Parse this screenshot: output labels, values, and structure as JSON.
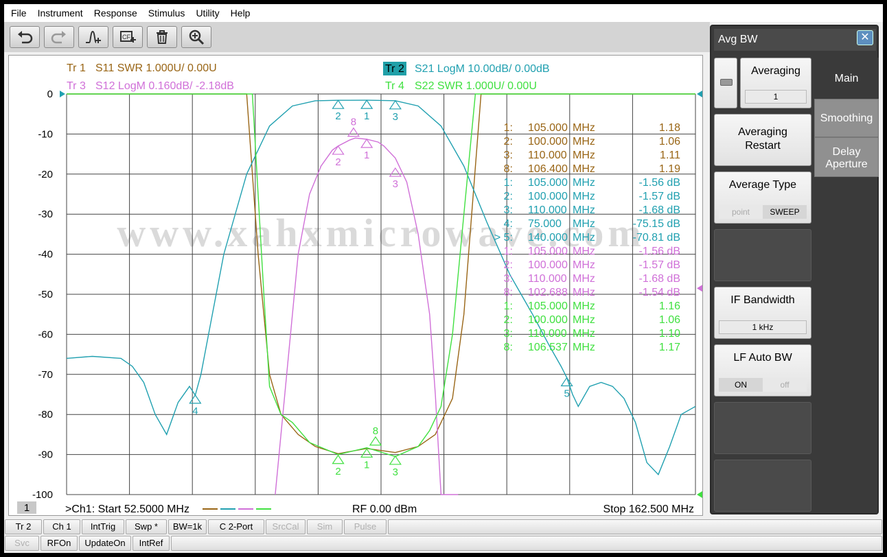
{
  "menu": [
    "File",
    "Instrument",
    "Response",
    "Stimulus",
    "Utility",
    "Help"
  ],
  "toolbar": [
    "undo-icon",
    "redo-icon",
    "add-marker-icon",
    "calibration-icon",
    "delete-icon",
    "zoom-icon"
  ],
  "traces_header": {
    "tr1_tag": "Tr 1",
    "tr1_text": "S11 SWR 1.000U/  0.00U",
    "tr2_tag": "Tr 2",
    "tr2_text": "S21 LogM 10.00dB/  0.00dB",
    "tr3_tag": "Tr 3",
    "tr3_text": "S12 LogM 0.160dB/  -2.18dB",
    "tr4_tag": "Tr 4",
    "tr4_text": "S22 SWR 1.000U/  0.00U"
  },
  "colors": {
    "tr1": "#996515",
    "tr2": "#20a0b0",
    "tr3": "#d070d8",
    "tr4": "#40e040"
  },
  "watermark": "www.xahxmicrowave.com",
  "channel_footer": {
    "channel_num": "1",
    "start": ">Ch1:  Start  52.5000 MHz",
    "rf": "RF     0.00 dBm",
    "stop": "Stop  162.500 MHz"
  },
  "marker_table": [
    {
      "id": "1:",
      "freq": "105.000",
      "unit": "MHz",
      "val": "1.18",
      "tr": "tr1"
    },
    {
      "id": "2:",
      "freq": "100.000",
      "unit": "MHz",
      "val": "1.06",
      "tr": "tr1"
    },
    {
      "id": "3:",
      "freq": "110.000",
      "unit": "MHz",
      "val": "1.11",
      "tr": "tr1"
    },
    {
      "id": "8:",
      "freq": "106.400",
      "unit": "MHz",
      "val": "1.19",
      "tr": "tr1"
    },
    {
      "id": "1:",
      "freq": "105.000",
      "unit": "MHz",
      "val": "-1.56 dB",
      "tr": "tr2"
    },
    {
      "id": "2:",
      "freq": "100.000",
      "unit": "MHz",
      "val": "-1.57 dB",
      "tr": "tr2"
    },
    {
      "id": "3:",
      "freq": "110.000",
      "unit": "MHz",
      "val": "-1.68 dB",
      "tr": "tr2"
    },
    {
      "id": "4:",
      "freq": "75.000",
      "unit": "MHz",
      "val": "-75.15 dB",
      "tr": "tr2"
    },
    {
      "id": "> 5:",
      "freq": "140.000",
      "unit": "MHz",
      "val": "-70.81 dB",
      "tr": "tr2"
    },
    {
      "id": "1:",
      "freq": "105.000",
      "unit": "MHz",
      "val": "-1.56 dB",
      "tr": "tr3"
    },
    {
      "id": "2:",
      "freq": "100.000",
      "unit": "MHz",
      "val": "-1.57 dB",
      "tr": "tr3"
    },
    {
      "id": "3:",
      "freq": "110.000",
      "unit": "MHz",
      "val": "-1.68 dB",
      "tr": "tr3"
    },
    {
      "id": "8:",
      "freq": "102.688",
      "unit": "MHz",
      "val": "-1.54 dB",
      "tr": "tr3"
    },
    {
      "id": "1:",
      "freq": "105.000",
      "unit": "MHz",
      "val": "1.16",
      "tr": "tr4"
    },
    {
      "id": "2:",
      "freq": "100.000",
      "unit": "MHz",
      "val": "1.06",
      "tr": "tr4"
    },
    {
      "id": "3:",
      "freq": "110.000",
      "unit": "MHz",
      "val": "1.10",
      "tr": "tr4"
    },
    {
      "id": "8:",
      "freq": "106.537",
      "unit": "MHz",
      "val": "1.17",
      "tr": "tr4"
    }
  ],
  "chart_data": {
    "type": "line",
    "x_unit": "MHz",
    "xlim": [
      52.5,
      162.5
    ],
    "ylim": [
      -100,
      0
    ],
    "yticks": [
      0,
      -10,
      -20,
      -30,
      -40,
      -50,
      -60,
      -70,
      -80,
      -90,
      -100
    ],
    "grid": true,
    "series": [
      {
        "name": "S11 SWR",
        "trace": "tr1",
        "x": [
          52.5,
          84,
          86,
          88,
          90,
          93,
          96,
          100,
          105,
          110,
          114,
          117,
          120,
          122,
          125,
          162.5
        ],
        "y": [
          0,
          0,
          -40,
          -70,
          -80,
          -85,
          -88,
          -89.8,
          -88.5,
          -89.5,
          -88,
          -85,
          -76,
          -55,
          0,
          0
        ]
      },
      {
        "name": "S21 LogM",
        "trace": "tr2",
        "x": [
          52.5,
          57,
          62,
          64,
          66,
          68,
          70,
          72,
          74,
          75,
          76,
          78,
          80,
          84,
          88,
          92,
          96,
          100,
          105,
          110,
          114,
          118,
          122,
          126,
          130,
          134,
          137,
          139,
          140,
          141,
          142,
          144,
          146,
          148,
          150,
          152,
          154,
          156,
          158,
          160,
          162.5
        ],
        "y": [
          -66,
          -65.5,
          -66,
          -68,
          -72,
          -80,
          -85,
          -77,
          -73,
          -75.2,
          -70,
          -55,
          -40,
          -20,
          -8,
          -3,
          -1.7,
          -1.57,
          -1.56,
          -1.68,
          -3,
          -8,
          -18,
          -32,
          -45,
          -55,
          -63,
          -68,
          -70.8,
          -75,
          -78,
          -73,
          -72,
          -73,
          -76,
          -82,
          -92,
          -95,
          -88,
          -80,
          -78
        ]
      },
      {
        "name": "S12 LogM",
        "trace": "tr3",
        "x": [
          89,
          91,
          93,
          95,
          97,
          99,
          100,
          102,
          103,
          105,
          107,
          108,
          110,
          112,
          114,
          116,
          117,
          118,
          121
        ],
        "y": [
          -100,
          -70,
          -40,
          -25,
          -18,
          -14,
          -13,
          -11.5,
          -11,
          -11.3,
          -12,
          -13,
          -16,
          -22,
          -35,
          -55,
          -75,
          -100,
          -100
        ]
      },
      {
        "name": "S22 SWR",
        "trace": "tr4",
        "x": [
          52.5,
          85,
          87,
          88,
          90,
          92,
          95,
          100,
          105,
          110,
          114,
          116,
          118,
          120,
          122,
          124,
          162.5
        ],
        "y": [
          0,
          0,
          -50,
          -73,
          -80,
          -82,
          -87,
          -90,
          -88.3,
          -90.5,
          -88,
          -84,
          -78,
          -60,
          -30,
          0,
          0
        ]
      }
    ],
    "markers": [
      {
        "tr": "tr2",
        "label": "1",
        "x": 105,
        "y": -1.56
      },
      {
        "tr": "tr2",
        "label": "2",
        "x": 100,
        "y": -1.57
      },
      {
        "tr": "tr2",
        "label": "3",
        "x": 110,
        "y": -1.68
      },
      {
        "tr": "tr2",
        "label": "4",
        "x": 75,
        "y": -75.15
      },
      {
        "tr": "tr2",
        "label": "5",
        "x": 140,
        "y": -70.81
      },
      {
        "tr": "tr3",
        "label": "1",
        "x": 105,
        "y": -11.3
      },
      {
        "tr": "tr3",
        "label": "2",
        "x": 100,
        "y": -13
      },
      {
        "tr": "tr3",
        "label": "3",
        "x": 110,
        "y": -18.5
      },
      {
        "tr": "tr3",
        "label": "8",
        "x": 102.688,
        "y": -8.5
      },
      {
        "tr": "tr4",
        "label": "1",
        "x": 105,
        "y": -88.6
      },
      {
        "tr": "tr4",
        "label": "2",
        "x": 100,
        "y": -90.2
      },
      {
        "tr": "tr4",
        "label": "3",
        "x": 110,
        "y": -90.4
      },
      {
        "tr": "tr4",
        "label": "8",
        "x": 106.537,
        "y": -85.6
      }
    ]
  },
  "panel": {
    "title": "Avg BW",
    "close": "✕",
    "averaging_label": "Averaging",
    "averaging_value": "1",
    "restart_label": "Averaging Restart",
    "avg_type_label": "Average Type",
    "avg_type_opt1": "point",
    "avg_type_opt2": "SWEEP",
    "ifbw_label": "IF Bandwidth",
    "ifbw_value": "1 kHz",
    "lfauto_label": "LF Auto BW",
    "lfauto_on": "ON",
    "lfauto_off": "off",
    "tabs": [
      "Main",
      "Smoothing",
      "Delay Aperture"
    ]
  },
  "status1": [
    {
      "label": "Tr 2",
      "dis": false
    },
    {
      "label": "Ch 1",
      "dis": false
    },
    {
      "label": "IntTrig",
      "dis": false
    },
    {
      "label": "Swp *",
      "dis": false
    },
    {
      "label": "BW=1k",
      "dis": false
    },
    {
      "label": "C  2-Port",
      "dis": false
    },
    {
      "label": "SrcCal",
      "dis": true
    },
    {
      "label": "Sim",
      "dis": true
    },
    {
      "label": "Pulse",
      "dis": true
    }
  ],
  "status2": [
    {
      "label": "Svc",
      "dis": true
    },
    {
      "label": "RFOn",
      "dis": false
    },
    {
      "label": "UpdateOn",
      "dis": false
    },
    {
      "label": "IntRef",
      "dis": false
    }
  ]
}
